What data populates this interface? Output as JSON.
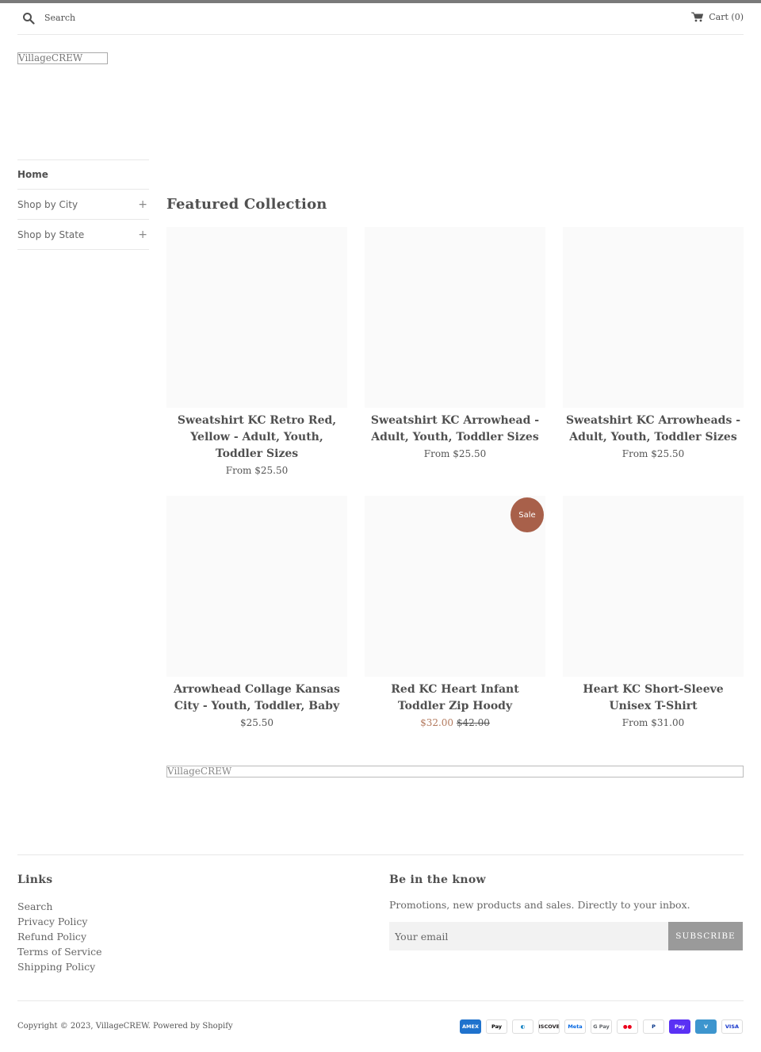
{
  "header": {
    "search_placeholder": "Search",
    "cart_label": "Cart (0)",
    "logo_text": "VillageCREW"
  },
  "sidebar": {
    "items": [
      {
        "label": "Home",
        "active": true
      },
      {
        "label": "Shop by City",
        "expandable": true
      },
      {
        "label": "Shop by State",
        "expandable": true
      }
    ],
    "expand_symbol": "+"
  },
  "main": {
    "collection_title": "Featured Collection",
    "products": [
      {
        "title": "Sweatshirt KC Retro Red, Yellow - Adult, Youth, Toddler Sizes",
        "price": "From $25.50"
      },
      {
        "title": "Sweatshirt KC Arrowhead - Adult, Youth, Toddler Sizes",
        "price": "From $25.50"
      },
      {
        "title": "Sweatshirt KC Arrowheads - Adult, Youth, Toddler Sizes",
        "price": "From $25.50"
      },
      {
        "title": "Arrowhead Collage Kansas City - Youth, Toddler, Baby",
        "price": "$25.50"
      },
      {
        "title": "Red KC Heart Infant Toddler Zip Hoody",
        "sale_price": "$32.00",
        "compare_price": "$42.00",
        "badge": "Sale"
      },
      {
        "title": "Heart KC Short-Sleeve Unisex T-Shirt",
        "price": "From $31.00"
      }
    ],
    "bottom_logo_text": "VillageCREW"
  },
  "footer": {
    "links_heading": "Links",
    "links": [
      "Search",
      "Privacy Policy",
      "Refund Policy",
      "Terms of Service",
      "Shipping Policy"
    ],
    "newsletter_heading": "Be in the know",
    "newsletter_desc": "Promotions, new products and sales. Directly to your inbox.",
    "email_placeholder": "Your email",
    "subscribe_label": "SUBSCRIBE",
    "copyright": "Copyright © 2023, VillageCREW. Powered by Shopify",
    "payment_methods": [
      {
        "name": "american-express",
        "label": "AMEX",
        "bg": "#1f72cd",
        "fg": "#ffffff"
      },
      {
        "name": "apple-pay",
        "label": "Pay",
        "bg": "#ffffff",
        "fg": "#000000"
      },
      {
        "name": "diners-club",
        "label": "◐",
        "bg": "#ffffff",
        "fg": "#0079be"
      },
      {
        "name": "discover",
        "label": "DISCOVER",
        "bg": "#ffffff",
        "fg": "#231f20"
      },
      {
        "name": "meta-pay",
        "label": "Meta",
        "bg": "#ffffff",
        "fg": "#0668e1"
      },
      {
        "name": "google-pay",
        "label": "G Pay",
        "bg": "#ffffff",
        "fg": "#5f6368"
      },
      {
        "name": "mastercard",
        "label": "●●",
        "bg": "#ffffff",
        "fg": "#eb001b"
      },
      {
        "name": "paypal",
        "label": "P",
        "bg": "#ffffff",
        "fg": "#003087"
      },
      {
        "name": "shop-pay",
        "label": "Pay",
        "bg": "#5a31f4",
        "fg": "#ffffff"
      },
      {
        "name": "venmo",
        "label": "V",
        "bg": "#3d95ce",
        "fg": "#ffffff"
      },
      {
        "name": "visa",
        "label": "VISA",
        "bg": "#ffffff",
        "fg": "#1434cb"
      }
    ]
  },
  "colors": {
    "top_bar": "#7a7a7a",
    "sale_badge": "#a8604a",
    "sale_price": "#b37a5e",
    "subscribe_button": "#9a9a9a"
  }
}
